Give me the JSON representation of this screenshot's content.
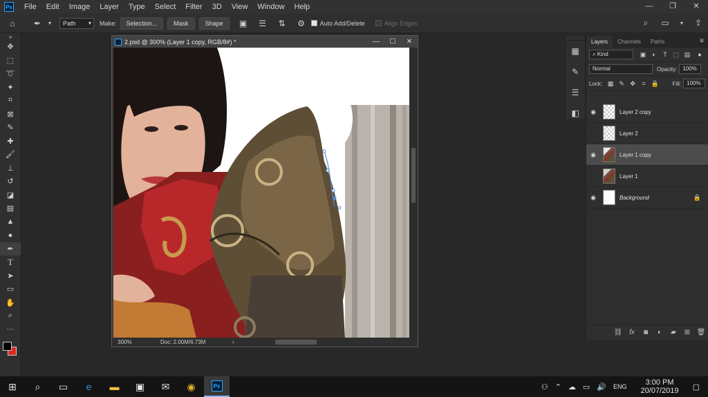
{
  "menubar": {
    "app_logo": "Ps",
    "items": [
      "File",
      "Edit",
      "Image",
      "Layer",
      "Type",
      "Select",
      "Filter",
      "3D",
      "View",
      "Window",
      "Help"
    ]
  },
  "options": {
    "mode_value": "Path",
    "make_label": "Make:",
    "selection_btn": "Selection...",
    "mask_btn": "Mask",
    "shape_btn": "Shape",
    "auto_add_delete": "Auto Add/Delete",
    "align_edges": "Align Edges"
  },
  "document": {
    "title": "2.psd @ 300% (Layer 1 copy, RGB/8#) *",
    "zoom": "300%",
    "doc_info": "Doc: 2.00M/6.73M"
  },
  "layers_panel": {
    "tabs": [
      "Layers",
      "Channels",
      "Paths"
    ],
    "kind_label": "Kind",
    "blend_mode": "Normal",
    "opacity_label": "Opacity:",
    "opacity_value": "100%",
    "lock_label": "Lock:",
    "fill_label": "Fill:",
    "fill_value": "100%",
    "layers": [
      {
        "name": "Layer 2 copy",
        "visible": true
      },
      {
        "name": "Layer 2",
        "visible": false
      },
      {
        "name": "Layer 1 copy",
        "visible": true,
        "selected": true
      },
      {
        "name": "Layer 1",
        "visible": false
      },
      {
        "name": "Background",
        "visible": true,
        "locked": true
      }
    ]
  },
  "taskbar": {
    "lang": "ENG",
    "time": "3:00 PM",
    "date": "20/07/2019"
  },
  "colors": {
    "foreground": "#000000",
    "background": "#d82a1e"
  }
}
